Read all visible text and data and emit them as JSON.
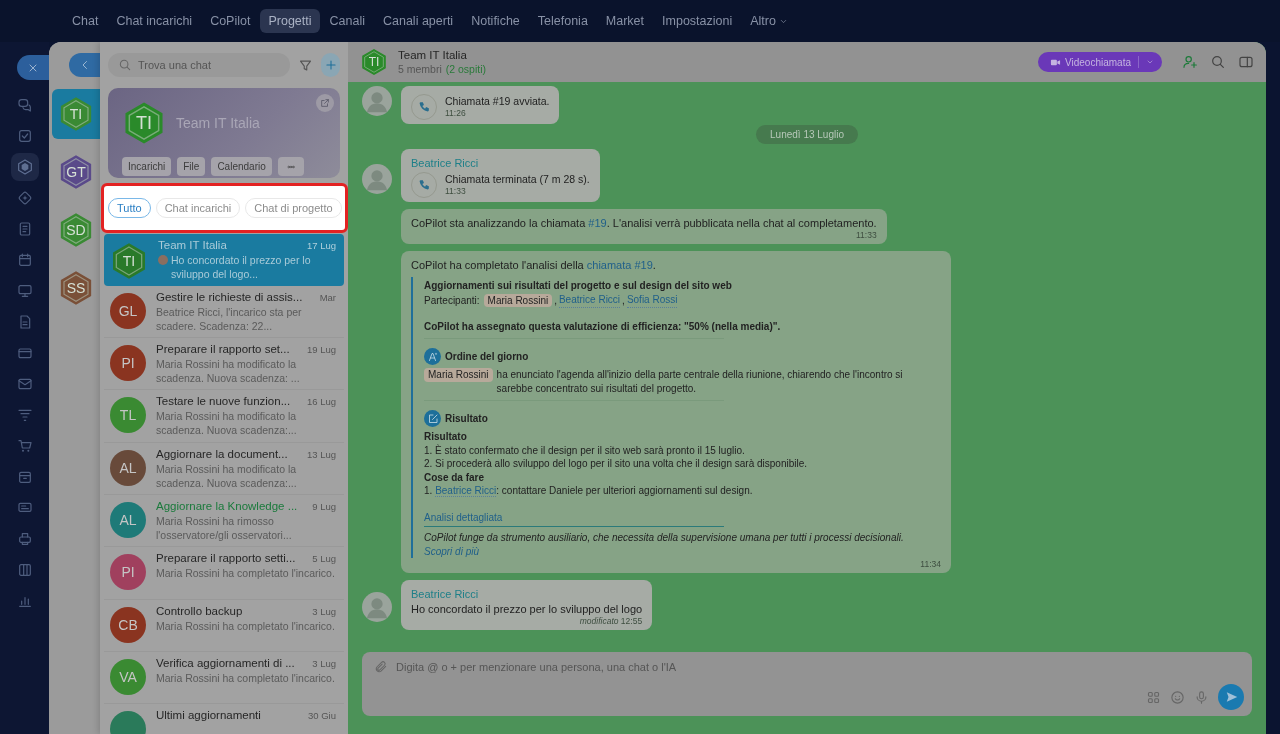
{
  "top_nav": {
    "items": [
      {
        "label": "Chat",
        "selected": false,
        "has_menu": false
      },
      {
        "label": "Chat incarichi",
        "selected": false,
        "has_menu": false
      },
      {
        "label": "CoPilot",
        "selected": false,
        "has_menu": false
      },
      {
        "label": "Progetti",
        "selected": true,
        "has_menu": false
      },
      {
        "label": "Canali",
        "selected": false,
        "has_menu": false
      },
      {
        "label": "Canali aperti",
        "selected": false,
        "has_menu": false
      },
      {
        "label": "Notifiche",
        "selected": false,
        "has_menu": false
      },
      {
        "label": "Telefonia",
        "selected": false,
        "has_menu": false
      },
      {
        "label": "Market",
        "selected": false,
        "has_menu": false
      },
      {
        "label": "Impostazioni",
        "selected": false,
        "has_menu": false
      },
      {
        "label": "Altro",
        "selected": false,
        "has_menu": true
      }
    ]
  },
  "rail_icons": [
    {
      "selected": false
    },
    {
      "selected": false
    },
    {
      "selected": true
    },
    {
      "selected": false
    },
    {
      "selected": false
    },
    {
      "selected": false
    },
    {
      "selected": false
    },
    {
      "selected": false
    },
    {
      "selected": false
    },
    {
      "selected": false
    },
    {
      "selected": false
    },
    {
      "selected": false
    },
    {
      "selected": false
    },
    {
      "selected": false
    },
    {
      "selected": false
    },
    {
      "selected": false
    },
    {
      "selected": false
    }
  ],
  "recent_chats": [
    {
      "initials": "TI",
      "color": "#3a8a34",
      "selected": true
    },
    {
      "initials": "GT",
      "color": "#5a4a8a",
      "selected": false
    },
    {
      "initials": "SD",
      "color": "#3a8a34",
      "selected": false
    },
    {
      "initials": "SS",
      "color": "#7a5038",
      "selected": false
    }
  ],
  "search": {
    "placeholder": "Trova una chat"
  },
  "project_card": {
    "initials": "TI",
    "title": "Team IT Italia",
    "buttons": [
      "Incarichi",
      "File",
      "Calendario"
    ]
  },
  "filters": [
    {
      "label": "Tutto",
      "selected": true
    },
    {
      "label": "Chat incarichi",
      "selected": false
    },
    {
      "label": "Chat di progetto",
      "selected": false
    }
  ],
  "chats": [
    {
      "kind": "project",
      "initials": "TI",
      "color": "#2a7a2a",
      "title": "Team IT Italia",
      "preview": "Ho concordato il prezzo per lo sviluppo del logo...",
      "date": "17 Lug",
      "selected": true,
      "highlighted": false
    },
    {
      "kind": "task",
      "initials": "GL",
      "color": "#8a3420",
      "title": "Gestire le richieste di assis...",
      "preview": "Beatrice Ricci, l'incarico sta per scadere. Scadenza: 22...",
      "date": "Mar",
      "selected": false,
      "highlighted": false
    },
    {
      "kind": "task",
      "initials": "PI",
      "color": "#8a3420",
      "title": "Preparare il rapporto set...",
      "preview": "Maria Rossini ha modificato la scadenza. Nuova scadenza: ...",
      "date": "19 Lug",
      "selected": false,
      "highlighted": false
    },
    {
      "kind": "task",
      "initials": "TL",
      "color": "#3a8a32",
      "title": "Testare le nuove funzion...",
      "preview": "Maria Rossini ha modificato la scadenza. Nuova scadenza:...",
      "date": "16 Lug",
      "selected": false,
      "highlighted": false
    },
    {
      "kind": "task",
      "initials": "AL",
      "color": "#684a3a",
      "title": "Aggiornare la document...",
      "preview": "Maria Rossini ha modificato la scadenza. Nuova scadenza:...",
      "date": "13 Lug",
      "selected": false,
      "highlighted": false
    },
    {
      "kind": "task",
      "initials": "AL",
      "color": "#1e7a78",
      "title": "Aggiornare la Knowledge ...",
      "preview": "Maria Rossini ha rimosso l'osservatore/gli osservatori...",
      "date": "9 Lug",
      "selected": false,
      "highlighted": true
    },
    {
      "kind": "task",
      "initials": "PI",
      "color": "#a0405e",
      "title": "Preparare il rapporto setti...",
      "preview": "Maria Rossini ha completato l'incarico.",
      "date": "5 Lug",
      "selected": false,
      "highlighted": false
    },
    {
      "kind": "task",
      "initials": "CB",
      "color": "#8a3420",
      "title": "Controllo backup",
      "preview": "Maria Rossini ha completato l'incarico.",
      "date": "3 Lug",
      "selected": false,
      "highlighted": false
    },
    {
      "kind": "task",
      "initials": "VA",
      "color": "#3a8a32",
      "title": "Verifica aggiornamenti di ...",
      "preview": "Maria Rossini ha completato l'incarico.",
      "date": "3 Lug",
      "selected": false,
      "highlighted": false
    },
    {
      "kind": "task",
      "color": "#2a7a5a",
      "title": "Ultimi aggiornamenti",
      "date": "30 Giu",
      "selected": false,
      "highlighted": false
    }
  ],
  "chat_header": {
    "initials": "TI",
    "title": "Team IT Italia",
    "members": "5 membri",
    "guests": "(2 ospiti)",
    "video_button": "Videochiamata"
  },
  "messages": [
    {
      "kind": "call",
      "text": "Chiamata #19 avviata.",
      "time": "11:26"
    },
    {
      "kind": "date",
      "text": "Lunedì 13 Luglio"
    },
    {
      "kind": "call",
      "author": "Beatrice Ricci",
      "text": "Chiamata terminata (7 m 28 s).",
      "time": "11:33"
    },
    {
      "kind": "system",
      "before": "CoPilot sta analizzando la chiamata ",
      "link": "#19",
      "after": ". L'analisi verrà pubblicata nella chat al completamento.",
      "time": "11:33"
    },
    {
      "kind": "analysis",
      "before": "CoPilot ha completato l'analisi della ",
      "link": "chiamata #19",
      "after": ".",
      "title": "Aggiornamenti sui risultati del progetto e sul design del sito web",
      "participants_label": "Partecipanti:",
      "separator": ",",
      "participants": [
        {
          "name": "Maria Rossini",
          "kind": "chip"
        },
        {
          "name": "Beatrice Ricci",
          "kind": "link"
        },
        {
          "name": "Sofia Rossi",
          "kind": "link"
        }
      ],
      "rating": "CoPilot ha assegnato questa valutazione di efficienza: \"50% (nella media)\".",
      "agenda_heading": "Ordine del giorno",
      "agenda_person": "Maria Rossini",
      "agenda_text": "ha enunciato l'agenda all'inizio della parte centrale della riunione, chiarendo che l'incontro si sarebbe concentrato sui risultati del progetto.",
      "result_heading": "Risultato",
      "result_subheading": "Risultato",
      "result_items": [
        "1. È stato confermato che il design per il sito web sarà pronto il 15 luglio.",
        "2. Si procederà allo sviluppo del logo per il sito una volta che il design sarà disponibile."
      ],
      "todo_heading": "Cose da fare",
      "todos": [
        {
          "number": "1.",
          "person": "Beatrice Ricci",
          "text": ": contattare Daniele per ulteriori aggiornamenti sul design."
        }
      ],
      "details_link": "Analisi dettagliata",
      "disclaimer": "CoPilot funge da strumento ausiliario, che necessita della supervisione umana per tutti i processi decisionali.",
      "learn_more": "Scopri di più",
      "time": "11:34"
    },
    {
      "kind": "text",
      "author": "Beatrice Ricci",
      "text": "Ho concordato il prezzo per lo sviluppo del logo",
      "edited": "modificato",
      "time": "12:55"
    }
  ],
  "composer": {
    "placeholder": "Digita @ o + per menzionare una persona, una chat o l'IA"
  }
}
